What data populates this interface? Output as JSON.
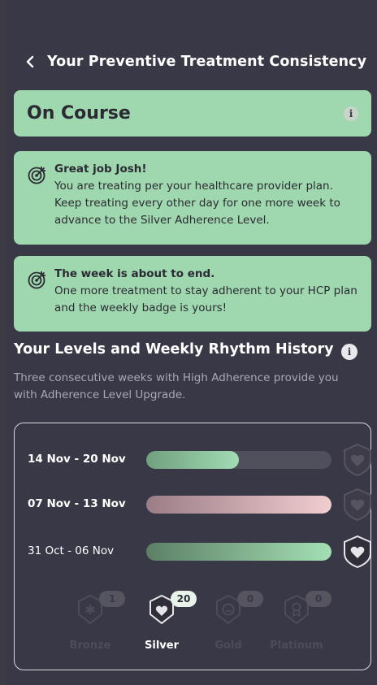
{
  "header": {
    "title": "Your Preventive Treatment Consistency"
  },
  "status": {
    "label": "On Course",
    "info_glyph": "i"
  },
  "messages": [
    {
      "title": "Great job Josh!",
      "body": "You are treating per your healthcare provider plan. Keep treating every other day for one more week to advance to the Silver Adherence Level.",
      "icon": "target-icon"
    },
    {
      "title": "The week is about to end.",
      "body": "One more treatment to stay adherent to your HCP plan and the weekly badge is yours!",
      "icon": "target-icon"
    }
  ],
  "history": {
    "title": "Your Levels and Weekly Rhythm History",
    "info_glyph": "i",
    "description": "Three consecutive weeks with High Adherence provide you with Adherence Level Upgrade.",
    "weeks": [
      {
        "label": "14 Nov - 20 Nov",
        "progress": 0.5,
        "colors": [
          "#6fa07f",
          "#a2dcb3"
        ],
        "badge_earned": false
      },
      {
        "label": "07 Nov - 13 Nov",
        "progress": 1.0,
        "colors": [
          "#9b7d87",
          "#f1cdcf"
        ],
        "badge_earned": false
      },
      {
        "label": "31 Oct - 06 Nov",
        "progress": 1.0,
        "colors": [
          "#5c7f66",
          "#a4dfb4"
        ],
        "badge_earned": true
      }
    ]
  },
  "levels": [
    {
      "name": "Bronze",
      "count": "1",
      "active": false,
      "icon": "asterisk-icon"
    },
    {
      "name": "Silver",
      "count": "20",
      "active": true,
      "icon": "heart-icon"
    },
    {
      "name": "Gold",
      "count": "0",
      "active": false,
      "icon": "smile-icon"
    },
    {
      "name": "Platinum",
      "count": "0",
      "active": false,
      "icon": "award-icon"
    }
  ],
  "colors": {
    "accent": "#9fd8ae",
    "background": "#393846",
    "muted": "#a9a8b2"
  }
}
